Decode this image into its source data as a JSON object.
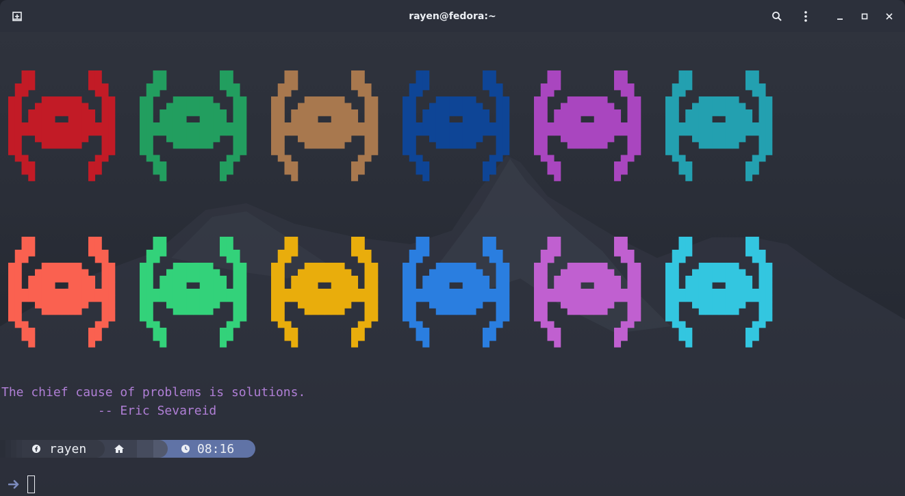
{
  "titlebar": {
    "title": "rayen@fedora:~",
    "new_tab_icon": "new-tab-icon",
    "search_icon": "search-icon",
    "menu_icon": "kebab-menu-icon",
    "minimize_icon": "minimize-icon",
    "maximize_icon": "maximize-icon",
    "close_icon": "close-icon"
  },
  "art": {
    "row1_colors": [
      "#c21b26",
      "#229e5f",
      "#a8784e",
      "#0e4596",
      "#a946bf",
      "#23a0b0"
    ],
    "row2_colors": [
      "#fa6150",
      "#33d27a",
      "#e9ad0c",
      "#2a7ee0",
      "#c060d0",
      "#33c6e0"
    ]
  },
  "quote": {
    "line1": "The chief cause of problems is solutions.",
    "line2": "             -- Eric Sevareid"
  },
  "prompt": {
    "user": "rayen",
    "user_icon": "fedora-icon",
    "home_icon": "home-icon",
    "time_icon": "clock-icon",
    "time": "08:16",
    "arrow_icon": "arrow-right-icon"
  },
  "colors": {
    "quote": "#b07fd6",
    "prompt_user_bg": "#3a3e4b",
    "prompt_home_bg": "#4a5163",
    "prompt_time_bg": "#5e6f9e",
    "prompt_arrow": "#7c8bbd"
  }
}
